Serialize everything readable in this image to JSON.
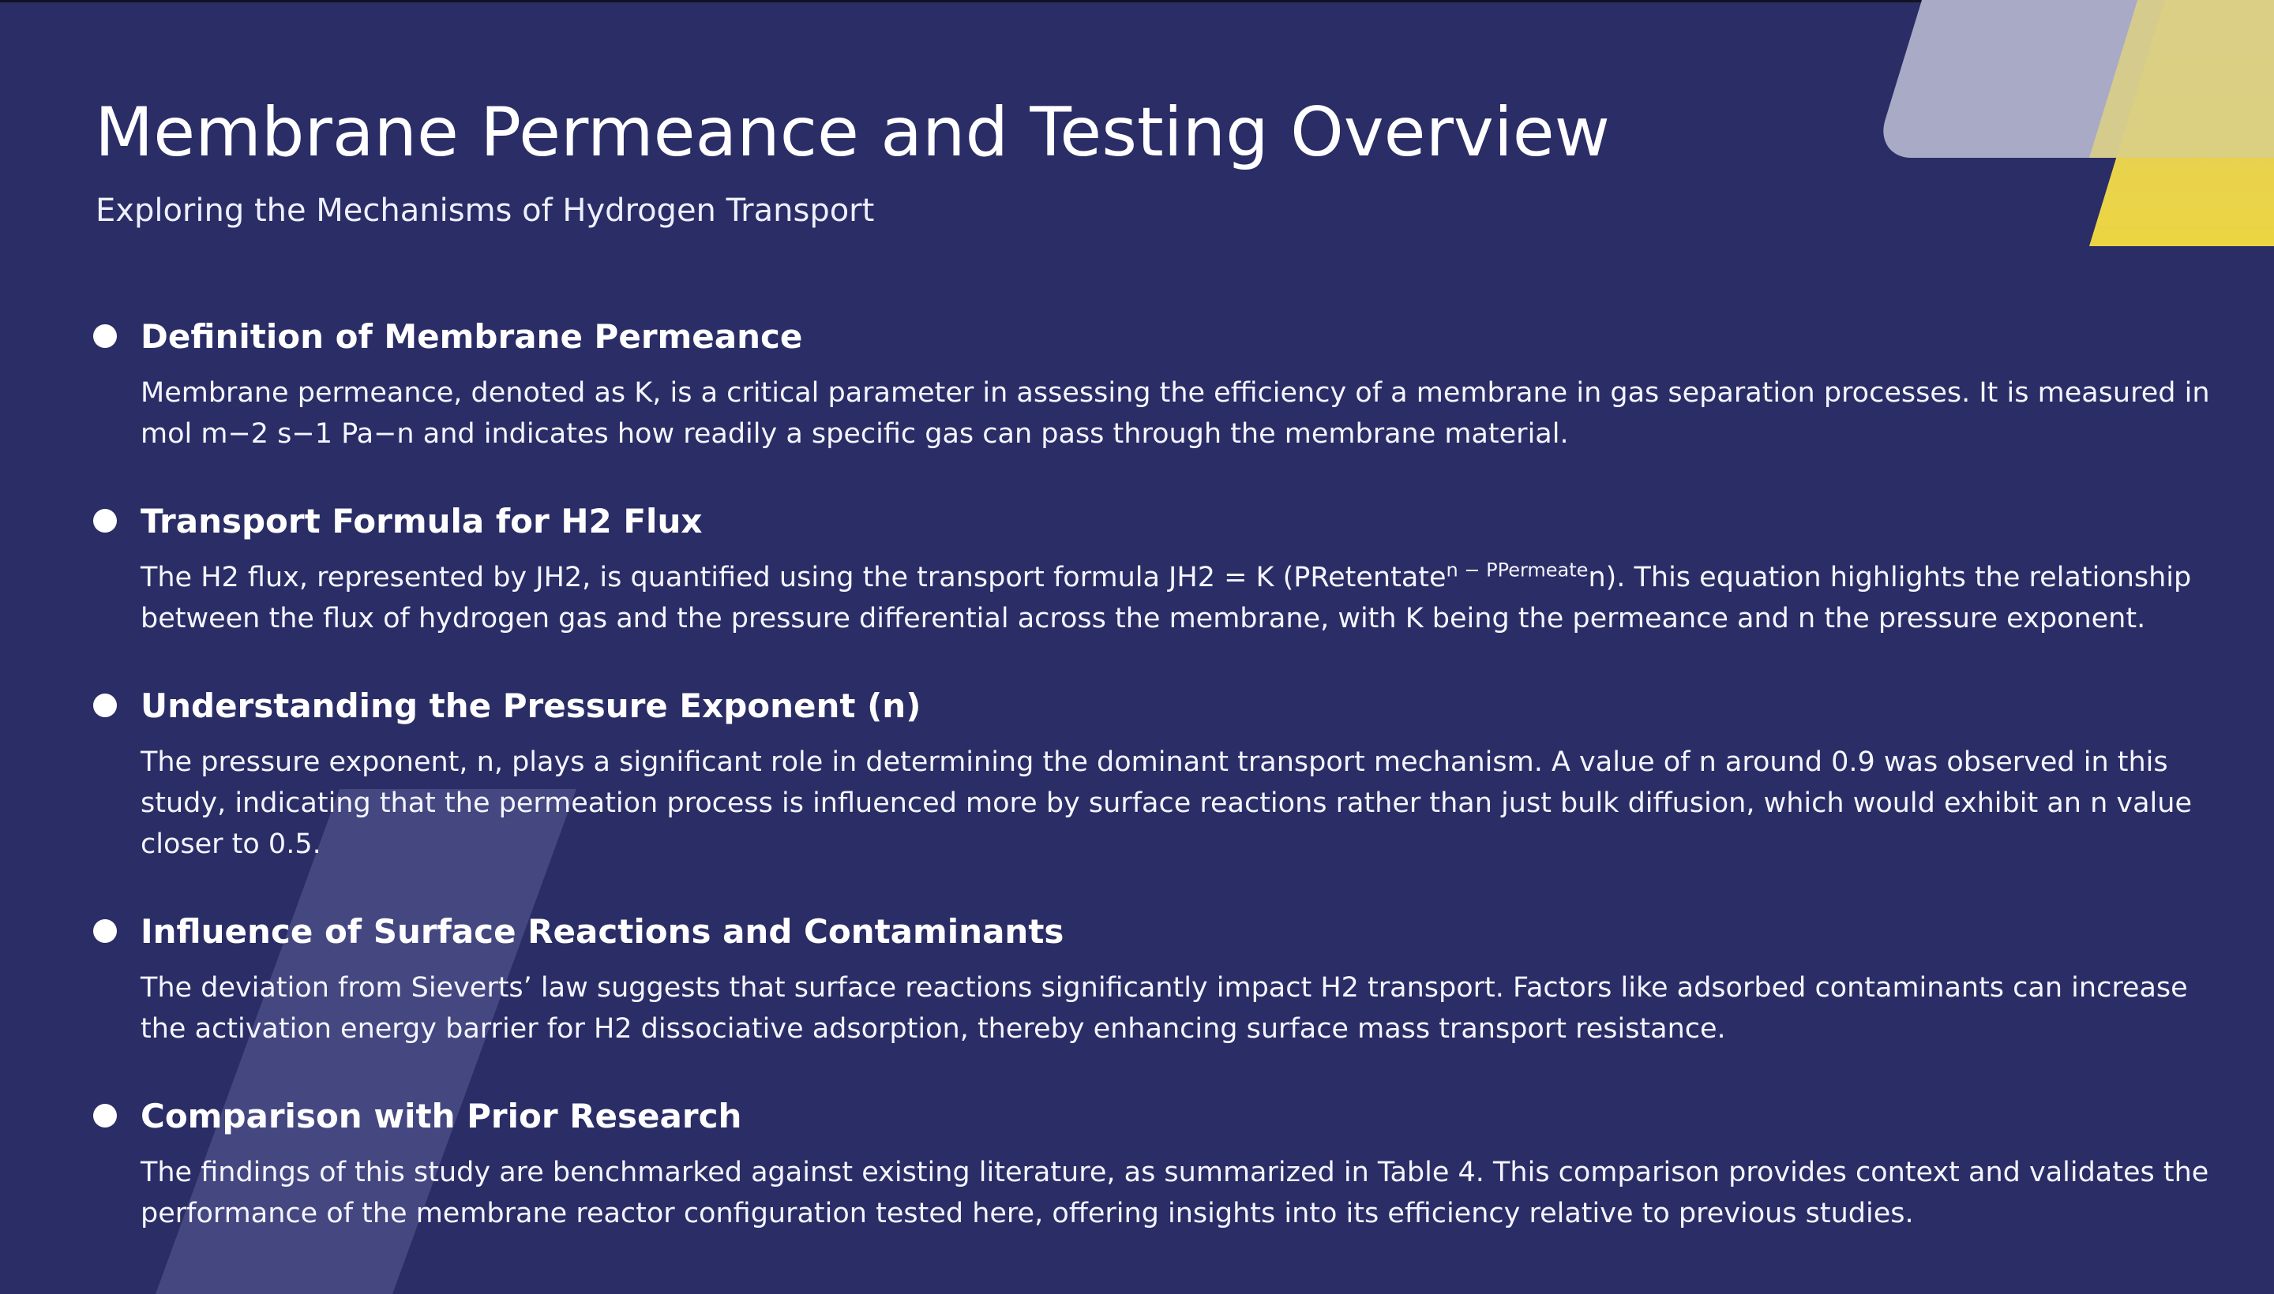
{
  "title": "Membrane Permeance and Testing Overview",
  "subtitle": "Exploring the Mechanisms of Hydrogen Transport",
  "sections": [
    {
      "heading": "Definition of Membrane Permeance",
      "body": "Membrane permeance, denoted as K, is a critical parameter in assessing the efficiency of a membrane in gas separation processes. It is measured in mol m−2 s−1 Pa−n and indicates how readily a specific gas can pass through the membrane material."
    },
    {
      "heading": "Transport Formula for H2 Flux",
      "body_prefix": "The H2 flux, represented by JH2, is quantified using the transport formula JH2 = K (PRetentate",
      "body_superscript": "n − PPermeate",
      "body_suffix": "n). This equation highlights the relationship between the flux of hydrogen gas and the pressure differential across the membrane, with K being the permeance and n the pressure exponent."
    },
    {
      "heading": "Understanding the Pressure Exponent (n)",
      "body": "The pressure exponent, n, plays a significant role in determining the dominant transport mechanism. A value of n around 0.9 was observed in this study, indicating that the permeation process is influenced more by surface reactions rather than just bulk diffusion, which would exhibit an n value closer to 0.5."
    },
    {
      "heading": "Influence of Surface Reactions and Contaminants",
      "body": "The deviation from Sieverts’ law suggests that surface reactions significantly impact H2 transport. Factors like adsorbed contaminants can increase the activation energy barrier for H2 dissociative adsorption, thereby enhancing surface mass transport resistance."
    },
    {
      "heading": "Comparison with Prior Research",
      "body": "The findings of this study are benchmarked against existing literature, as summarized in Table 4. This comparison provides context and validates the performance of the membrane reactor configuration tested here, offering insights into its efficiency relative to previous studies."
    }
  ],
  "colors": {
    "background": "#2b2d66",
    "accent_yellow": "#ecd542",
    "accent_gray": "#a9aac6",
    "text": "#ffffff"
  }
}
